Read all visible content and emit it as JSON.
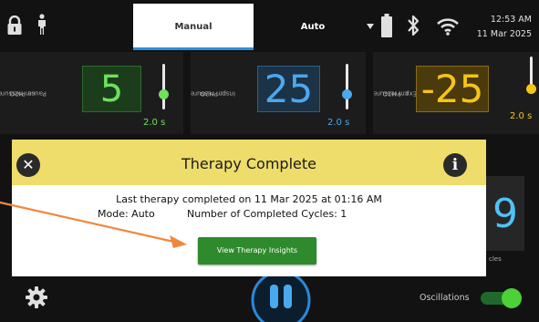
{
  "header": {
    "tabs": [
      {
        "label": "Manual",
        "selected": true
      },
      {
        "label": "Auto",
        "selected": false
      }
    ],
    "time": "12:53 AM",
    "date": "11 Mar 2025",
    "icons": [
      "lock-icon",
      "person-icon",
      "battery-icon",
      "bluetooth-icon",
      "wifi-icon"
    ]
  },
  "cards": {
    "pause": {
      "label_line1": "Pause Pressure",
      "label_line2": "cm H2O",
      "value": "5",
      "time": "2.0 s",
      "color": "#6ee05a"
    },
    "insp": {
      "label_line1": "Insp. Pressure",
      "label_line2": "cm H2O",
      "value": "25",
      "time": "2.0 s",
      "color": "#4aa8ee"
    },
    "exp": {
      "label_line1": "Exp. Pressure",
      "label_line2": "cm H2O",
      "value": "-25",
      "time": "2.0 s",
      "color": "#f5c518"
    }
  },
  "side": {
    "value": "9",
    "label": "cles"
  },
  "dialog": {
    "title": "Therapy Complete",
    "line1": "Last therapy completed on 11 Mar 2025 at 01:16 AM",
    "mode": "Mode: Auto",
    "cycles": "Number of Completed Cycles: 1",
    "button": "View Therapy Insights",
    "header_color": "#eedc6b",
    "button_color": "#2e8a2c"
  },
  "bottom": {
    "oscillations_label": "Oscillations",
    "oscillations_on": true
  },
  "annotation_arrow_color": "#f0883c"
}
